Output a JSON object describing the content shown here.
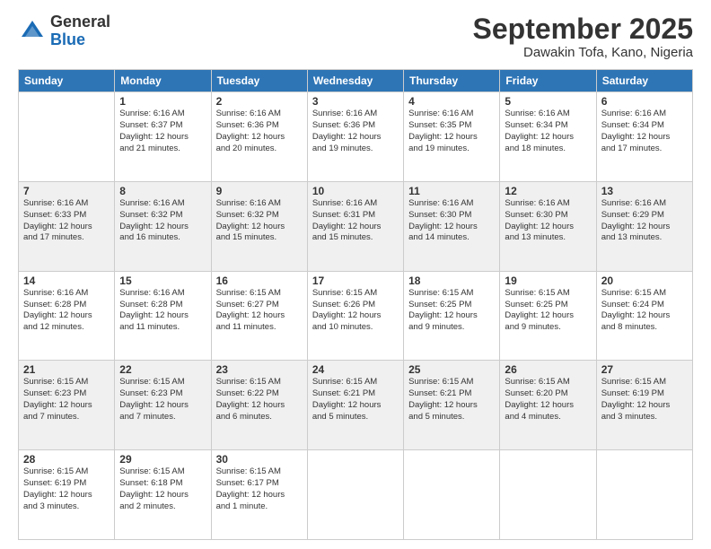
{
  "logo": {
    "general": "General",
    "blue": "Blue"
  },
  "title": "September 2025",
  "subtitle": "Dawakin Tofa, Kano, Nigeria",
  "days_of_week": [
    "Sunday",
    "Monday",
    "Tuesday",
    "Wednesday",
    "Thursday",
    "Friday",
    "Saturday"
  ],
  "weeks": [
    [
      {
        "day": "",
        "info": ""
      },
      {
        "day": "1",
        "info": "Sunrise: 6:16 AM\nSunset: 6:37 PM\nDaylight: 12 hours\nand 21 minutes."
      },
      {
        "day": "2",
        "info": "Sunrise: 6:16 AM\nSunset: 6:36 PM\nDaylight: 12 hours\nand 20 minutes."
      },
      {
        "day": "3",
        "info": "Sunrise: 6:16 AM\nSunset: 6:36 PM\nDaylight: 12 hours\nand 19 minutes."
      },
      {
        "day": "4",
        "info": "Sunrise: 6:16 AM\nSunset: 6:35 PM\nDaylight: 12 hours\nand 19 minutes."
      },
      {
        "day": "5",
        "info": "Sunrise: 6:16 AM\nSunset: 6:34 PM\nDaylight: 12 hours\nand 18 minutes."
      },
      {
        "day": "6",
        "info": "Sunrise: 6:16 AM\nSunset: 6:34 PM\nDaylight: 12 hours\nand 17 minutes."
      }
    ],
    [
      {
        "day": "7",
        "info": "Sunrise: 6:16 AM\nSunset: 6:33 PM\nDaylight: 12 hours\nand 17 minutes."
      },
      {
        "day": "8",
        "info": "Sunrise: 6:16 AM\nSunset: 6:32 PM\nDaylight: 12 hours\nand 16 minutes."
      },
      {
        "day": "9",
        "info": "Sunrise: 6:16 AM\nSunset: 6:32 PM\nDaylight: 12 hours\nand 15 minutes."
      },
      {
        "day": "10",
        "info": "Sunrise: 6:16 AM\nSunset: 6:31 PM\nDaylight: 12 hours\nand 15 minutes."
      },
      {
        "day": "11",
        "info": "Sunrise: 6:16 AM\nSunset: 6:30 PM\nDaylight: 12 hours\nand 14 minutes."
      },
      {
        "day": "12",
        "info": "Sunrise: 6:16 AM\nSunset: 6:30 PM\nDaylight: 12 hours\nand 13 minutes."
      },
      {
        "day": "13",
        "info": "Sunrise: 6:16 AM\nSunset: 6:29 PM\nDaylight: 12 hours\nand 13 minutes."
      }
    ],
    [
      {
        "day": "14",
        "info": "Sunrise: 6:16 AM\nSunset: 6:28 PM\nDaylight: 12 hours\nand 12 minutes."
      },
      {
        "day": "15",
        "info": "Sunrise: 6:16 AM\nSunset: 6:28 PM\nDaylight: 12 hours\nand 11 minutes."
      },
      {
        "day": "16",
        "info": "Sunrise: 6:15 AM\nSunset: 6:27 PM\nDaylight: 12 hours\nand 11 minutes."
      },
      {
        "day": "17",
        "info": "Sunrise: 6:15 AM\nSunset: 6:26 PM\nDaylight: 12 hours\nand 10 minutes."
      },
      {
        "day": "18",
        "info": "Sunrise: 6:15 AM\nSunset: 6:25 PM\nDaylight: 12 hours\nand 9 minutes."
      },
      {
        "day": "19",
        "info": "Sunrise: 6:15 AM\nSunset: 6:25 PM\nDaylight: 12 hours\nand 9 minutes."
      },
      {
        "day": "20",
        "info": "Sunrise: 6:15 AM\nSunset: 6:24 PM\nDaylight: 12 hours\nand 8 minutes."
      }
    ],
    [
      {
        "day": "21",
        "info": "Sunrise: 6:15 AM\nSunset: 6:23 PM\nDaylight: 12 hours\nand 7 minutes."
      },
      {
        "day": "22",
        "info": "Sunrise: 6:15 AM\nSunset: 6:23 PM\nDaylight: 12 hours\nand 7 minutes."
      },
      {
        "day": "23",
        "info": "Sunrise: 6:15 AM\nSunset: 6:22 PM\nDaylight: 12 hours\nand 6 minutes."
      },
      {
        "day": "24",
        "info": "Sunrise: 6:15 AM\nSunset: 6:21 PM\nDaylight: 12 hours\nand 5 minutes."
      },
      {
        "day": "25",
        "info": "Sunrise: 6:15 AM\nSunset: 6:21 PM\nDaylight: 12 hours\nand 5 minutes."
      },
      {
        "day": "26",
        "info": "Sunrise: 6:15 AM\nSunset: 6:20 PM\nDaylight: 12 hours\nand 4 minutes."
      },
      {
        "day": "27",
        "info": "Sunrise: 6:15 AM\nSunset: 6:19 PM\nDaylight: 12 hours\nand 3 minutes."
      }
    ],
    [
      {
        "day": "28",
        "info": "Sunrise: 6:15 AM\nSunset: 6:19 PM\nDaylight: 12 hours\nand 3 minutes."
      },
      {
        "day": "29",
        "info": "Sunrise: 6:15 AM\nSunset: 6:18 PM\nDaylight: 12 hours\nand 2 minutes."
      },
      {
        "day": "30",
        "info": "Sunrise: 6:15 AM\nSunset: 6:17 PM\nDaylight: 12 hours\nand 1 minute."
      },
      {
        "day": "",
        "info": ""
      },
      {
        "day": "",
        "info": ""
      },
      {
        "day": "",
        "info": ""
      },
      {
        "day": "",
        "info": ""
      }
    ]
  ]
}
